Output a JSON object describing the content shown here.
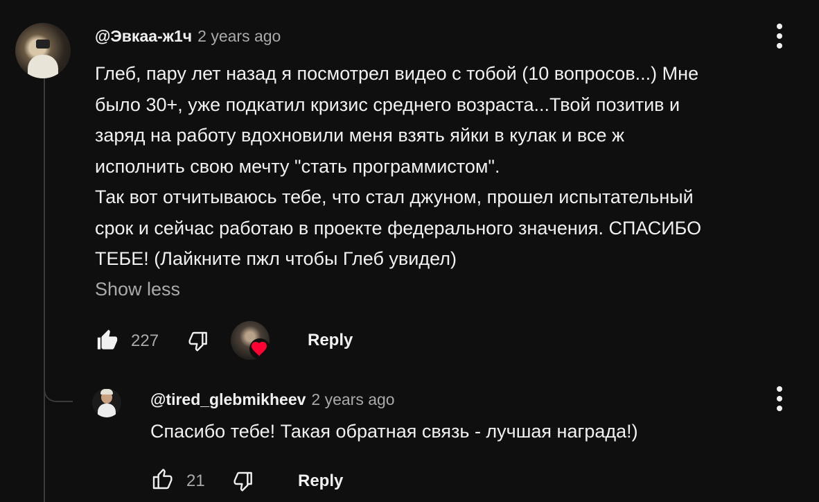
{
  "comment": {
    "author": "@Эвкаа-ж1ч",
    "time": "2 years ago",
    "text_lines": [
      "Глеб, пару лет назад я посмотрел видео с тобой (10 вопросов...) Мне",
      "было 30+, уже подкатил кризис среднего возраста...Твой позитив и",
      "заряд на работу вдохновили меня взять яйки в кулак и все ж",
      "исполнить свою мечту \"стать программистом\".",
      "Так вот отчитываюсь тебе, что стал джуном, прошел испытательный",
      "срок и сейчас работаю в проекте федерального значения. СПАСИБО",
      "ТЕБЕ! (Лайкните пжл чтобы Глеб увидел)"
    ],
    "show_less_label": "Show less",
    "like_count": "227",
    "reply_label": "Reply",
    "liked": true,
    "creator_hearted": true
  },
  "reply": {
    "author": "@tired_glebmikheev",
    "time": "2 years ago",
    "text": "Спасибо тебе! Такая обратная связь - лучшая награда!)",
    "like_count": "21",
    "reply_label": "Reply"
  },
  "colors": {
    "background": "#0f0f0f",
    "text_primary": "#f1f1f1",
    "text_secondary": "#aaaaaa",
    "heart": "#ff0033"
  }
}
